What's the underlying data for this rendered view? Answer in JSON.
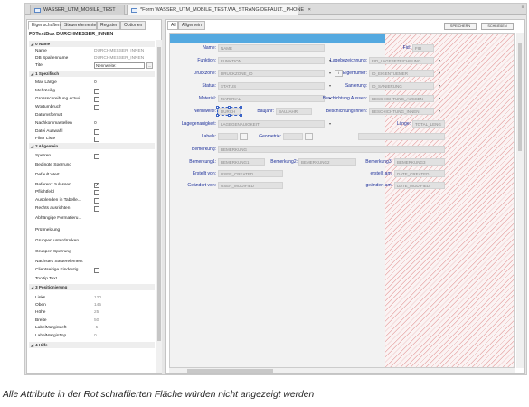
{
  "document_tabs": [
    {
      "label": "WASSER_UTM_MOBILE_TEST"
    },
    {
      "label": "*Form WASSER_UTM_MOBILE_TEST.WA_STRANG.DEFAULT._PHONE",
      "close": "×"
    }
  ],
  "menu_glyph": "≡",
  "properties": {
    "tabs": [
      "Eigenschaften",
      "Steuerelemente",
      "Register",
      "Optionen"
    ],
    "title": "FDTextBox DURCHMESSER_INNEN",
    "sections": {
      "name": "0 Name",
      "spezifisch": "1 Spezifisch",
      "allgemein": "2 Allgemein",
      "positionierung": "3 Positionierung",
      "hilfe": "4 Hilfe"
    },
    "rows": {
      "name": "Name",
      "name_val": "DURCHMESSER_INNEN",
      "db_spaltenname": "DB Spaltenname",
      "db_spaltenname_val": "DURCHMESSER_INNEN",
      "titel": "Titel",
      "titel_val": "Nennweite:",
      "max_laenge": "Max Länge",
      "max_laenge_val": "0",
      "mehrzeilig": "Mehrzeilig",
      "grossschreibung": "Grossschreibung erzwi...",
      "wortumbruch": "Wortumbruch",
      "datumsformat": "Datumsformat",
      "nachkommastellen": "Nachkommastellen",
      "nachkommastellen_val": "0",
      "datei_auswahl": "Datei Auswahl",
      "filter_liste": "Filter Liste",
      "sperren": "Sperren",
      "bedingte_sperrung": "Bedingte Sperrung",
      "default_wert": "Default Wert",
      "referenz_zulassen": "Referenz zulassen",
      "referenz_checked": "✔",
      "pflichtfeld": "Pflichtfeld",
      "ausblenden_tabelle": "Ausblenden in Tabelle...",
      "rechts_ausrichten": "Rechts ausrichten",
      "abhaengige_formatierung": "Abhängige Formatieru...",
      "pruefmeldung": "Prüfmeldung",
      "gruppen_unterdruecken": "Gruppen unterdrücken",
      "gruppen_sperrung": "Gruppen Sperrung",
      "naechstes_steuerelement": "Nächstes Steuerelement",
      "clientseitige_eindeutig": "Clientseitige Eindeutig...",
      "tooltip_text": "Tooltip Text",
      "links": "Links",
      "links_val": "120",
      "oben": "Oben",
      "oben_val": "145",
      "hoehe": "Höhe",
      "hoehe_val": "25",
      "breite": "Breite",
      "breite_val": "50",
      "label_margin_left": "LabelMarginLeft",
      "label_margin_left_val": "-5",
      "label_margin_top": "LabelMarginTop",
      "label_margin_top_val": "0"
    },
    "ellipsis": "..."
  },
  "designer": {
    "tabs": [
      "All",
      "Allgemein"
    ],
    "buttons": {
      "speichern": "SPEICHERN",
      "schliessen": "SCHLIEßEN"
    },
    "labels": {
      "name": "Name:",
      "fid": "Fid:",
      "funktion": "Funktion:",
      "lagebezeichnung": "Lagebezeichnung:",
      "druckzone": "Druckzone:",
      "eigentuemer": "Eigentümer:",
      "status": "Status:",
      "sanierung": "Sanierung:",
      "material": "Material:",
      "beschichtung_aussen": "Beschichtung Aussen:",
      "nennweite": "Nennweite:",
      "baujahr": "Baujahr:",
      "beschichtung_innen": "Beschichtung Innen:",
      "lagegenauigkeit": "Lagegenauigkeit:",
      "laenge": "Länge:",
      "labels": "Labels:",
      "geometrie": "Geometrie:",
      "bemerkung": "Bemerkung:",
      "bemerkung1": "Bemerkung1:",
      "bemerkung2": "Bemerkung2:",
      "bemerkung3": "Bemerkung3:",
      "erstellt_von": "Erstellt von:",
      "erstellt_am": "erstellt am:",
      "geaendert_von": "Geändert von:",
      "geaendert_am": "geändert am:"
    },
    "fields": {
      "name": "NAME",
      "fid": "FID",
      "funktion": "FUNKTION",
      "lagebezeichnung": "FID_LAGEBEZEICHNUNG",
      "druckzone": "DRUCKZONE_ID",
      "eigentuemer": "ID_EIGENTUEMER",
      "status": "STATUS",
      "sanierung": "ID_SANIERUNG",
      "material": "MATERIAL",
      "beschichtung_aussen": "BESCHICHTUNG_AUSSEN",
      "nennweite": "DURCH",
      "baujahr": "BAUJAHR",
      "beschichtung_innen": "BESCHICHTUNG_INNEN",
      "lagegenauigkeit": "LAGEGENAUIGKEIT",
      "laenge": "TOTAL_LENG",
      "bemerkung": "BEMERKUNG",
      "bemerkung1": "BEMERKUNG1",
      "bemerkung2": "BEMERKUNG2",
      "bemerkung3": "BEMERKUNG3",
      "erstellt_von": "USER_CREATED",
      "erstellt_am": "DATE_CREATED",
      "geaendert_von": "USER_MODIFIED",
      "geaendert_am": "DATE_MODIFIED"
    },
    "hatch_color": "#d66e6e",
    "accent_blue": "#54a9e0"
  },
  "caption": "Alle Attribute in der Rot schraffierten Fläche würden nicht angezeigt werden"
}
